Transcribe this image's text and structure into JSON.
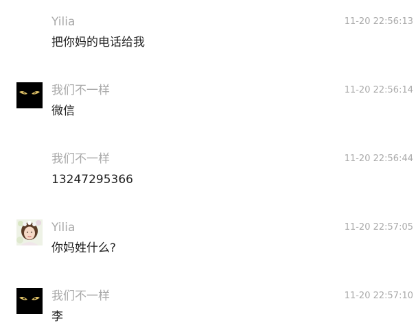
{
  "messages": [
    {
      "sender": "Yilia",
      "time": "11-20 22:56:13",
      "text": "把你妈的电话给我",
      "avatar": "none"
    },
    {
      "sender": "我们不一样",
      "time": "11-20 22:56:14",
      "text": "微信",
      "avatar": "black-cat-eyes-avatar"
    },
    {
      "sender": "我们不一样",
      "time": "11-20 22:56:44",
      "text": "13247295366",
      "avatar": "none"
    },
    {
      "sender": "Yilia",
      "time": "11-20 22:57:05",
      "text": "你妈姓什么?",
      "avatar": "girl-photo-avatar"
    },
    {
      "sender": "我们不一样",
      "time": "11-20 22:57:10",
      "text": "李",
      "avatar": "black-cat-eyes-avatar"
    }
  ],
  "colors": {
    "background": "#ffffff",
    "meta_text": "#a9a9a9",
    "body_text": "#1f1f1f"
  }
}
